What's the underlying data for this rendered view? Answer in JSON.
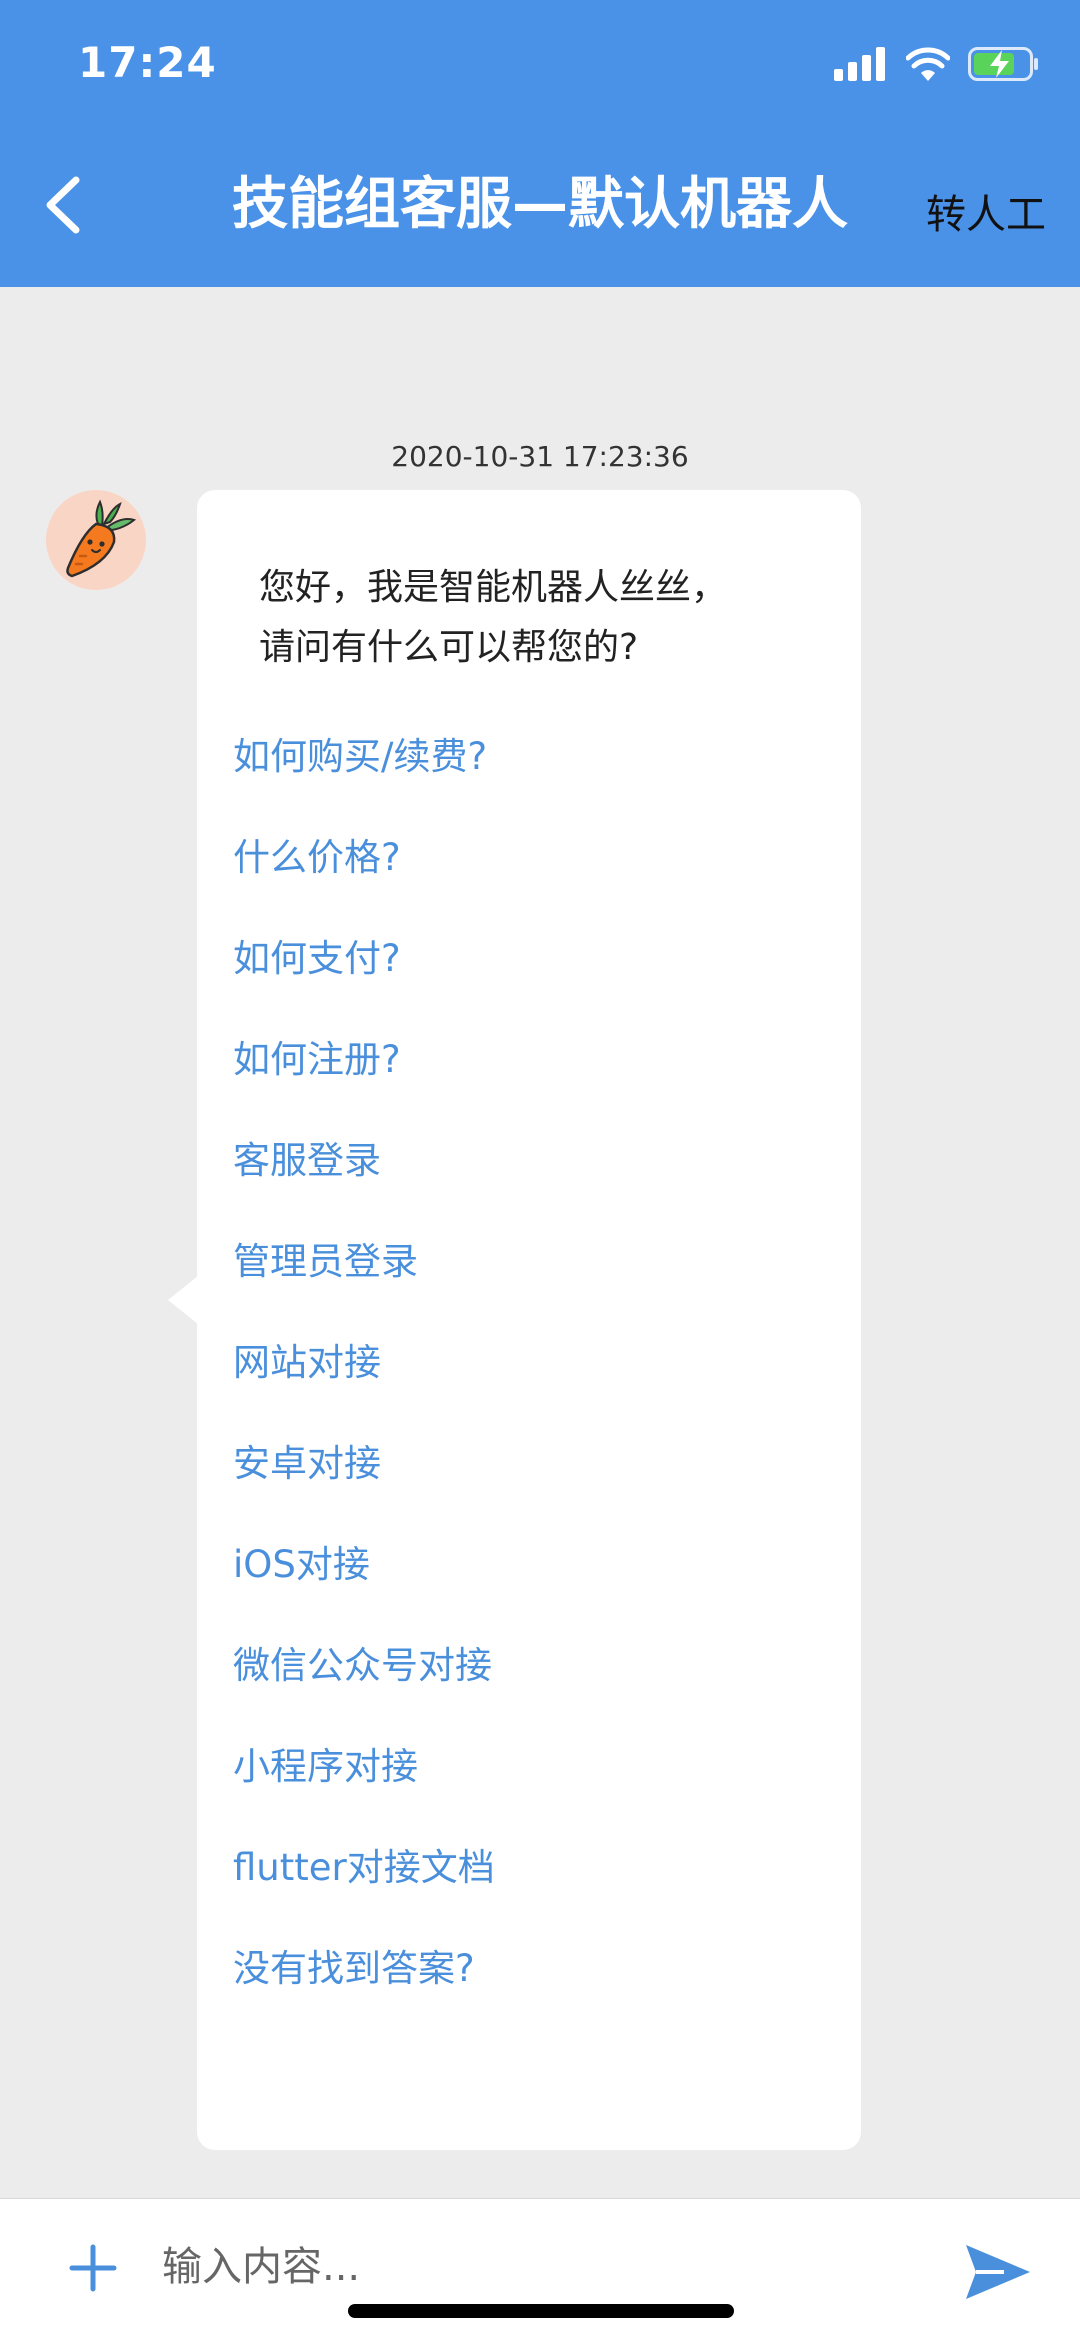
{
  "status_bar": {
    "time": "17:24"
  },
  "header": {
    "title": "技能组客服—默认机器人",
    "transfer_label": "转人工",
    "color": "#4a92e8"
  },
  "chat": {
    "timestamp": "2020-10-31 17:23:36",
    "bot_avatar_icon": "carrot-icon",
    "message": {
      "greeting_lines": [
        "您好，我是智能机器人丝丝，",
        "请问有什么可以帮您的?"
      ],
      "options": [
        "如何购买/续费?",
        "什么价格?",
        "如何支付?",
        "如何注册?",
        "客服登录",
        "管理员登录",
        "网站对接",
        "安卓对接",
        "iOS对接",
        "微信公众号对接",
        "小程序对接",
        "flutter对接文档",
        "没有找到答案?"
      ]
    }
  },
  "input_bar": {
    "placeholder": "输入内容...",
    "plus_icon": "plus-icon",
    "send_icon": "send-icon"
  }
}
